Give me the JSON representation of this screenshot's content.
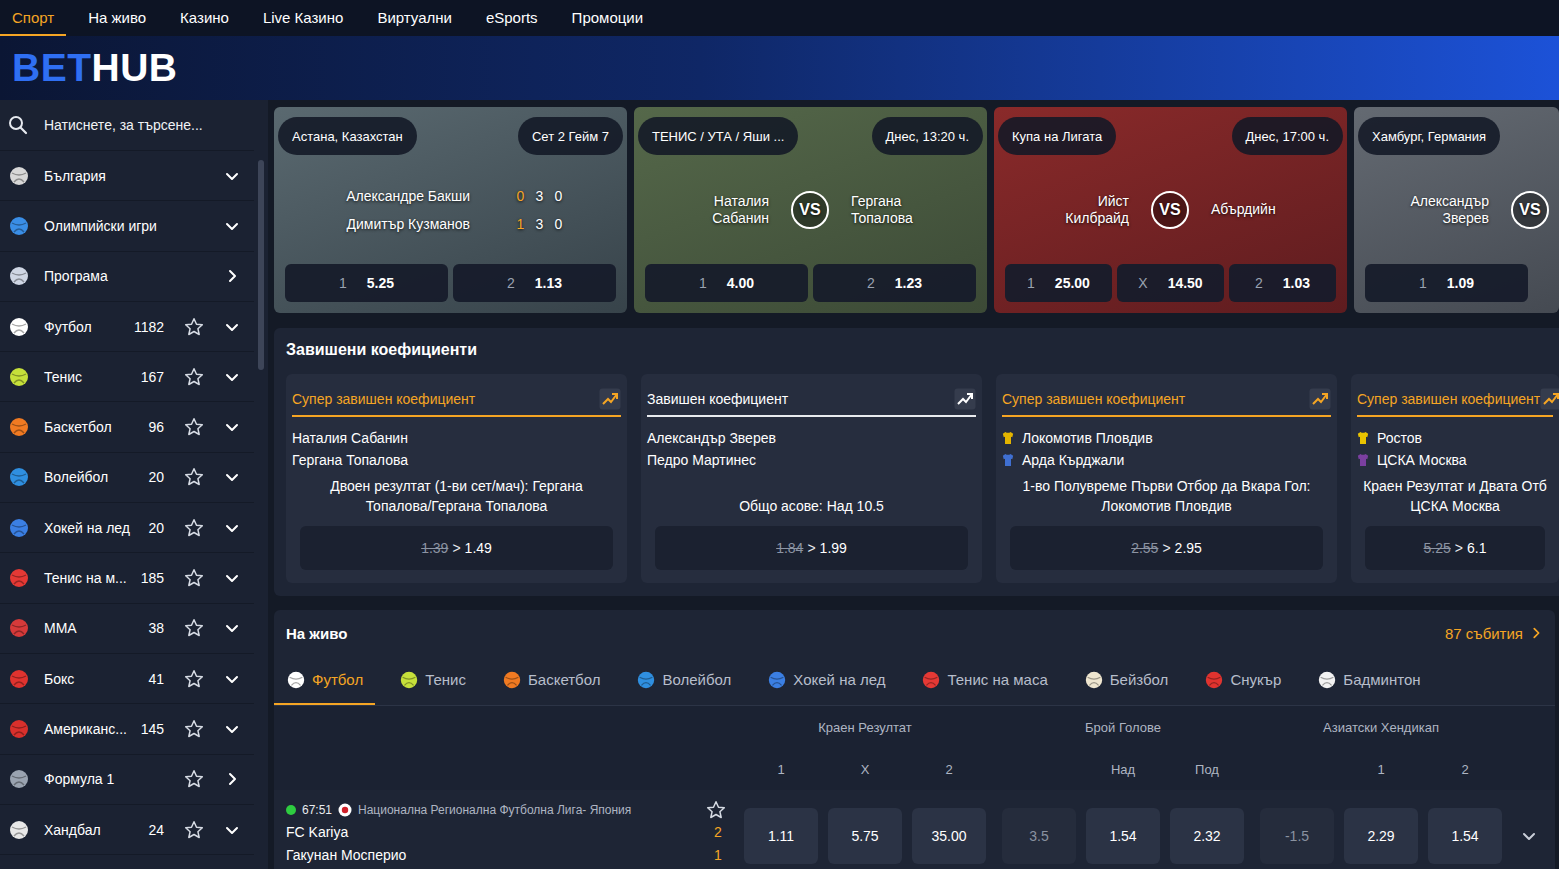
{
  "topnav": {
    "items": [
      {
        "label": "Спорт",
        "selected": true
      },
      {
        "label": "На живо",
        "selected": false
      },
      {
        "label": "Казино",
        "selected": false
      },
      {
        "label": "Live Казино",
        "selected": false
      },
      {
        "label": "Виртуални",
        "selected": false
      },
      {
        "label": "eSports",
        "selected": false
      },
      {
        "label": "Промоции",
        "selected": false
      }
    ]
  },
  "logo": {
    "accent": "BET",
    "rest": "HUB"
  },
  "sidebar": {
    "search": {
      "placeholder": "Натиснете, за търсене..."
    },
    "items": [
      {
        "label": "България",
        "kind": "group",
        "color": "#d8d8d8"
      },
      {
        "label": "Олимпийски игри",
        "kind": "group",
        "color": "#3a8ee6"
      },
      {
        "label": "Програма",
        "kind": "link",
        "color": "#cfd6e4"
      },
      {
        "label": "Футбол",
        "count": "1182",
        "kind": "sport",
        "favorite": false,
        "color": "#ffffff"
      },
      {
        "label": "Тенис",
        "count": "167",
        "kind": "sport",
        "favorite": false,
        "color": "#c6e03a"
      },
      {
        "label": "Баскетбол",
        "count": "96",
        "kind": "sport",
        "favorite": false,
        "color": "#f07a22"
      },
      {
        "label": "Волейбол",
        "count": "20",
        "kind": "sport",
        "favorite": false,
        "color": "#2f8fe0"
      },
      {
        "label": "Хокей на лед",
        "count": "20",
        "kind": "sport",
        "favorite": false,
        "color": "#3b7fe3"
      },
      {
        "label": "Тенис на м...",
        "count": "185",
        "kind": "sport",
        "favorite": false,
        "color": "#e53935"
      },
      {
        "label": "MMA",
        "count": "38",
        "kind": "sport",
        "favorite": false,
        "color": "#d63a3a"
      },
      {
        "label": "Бокс",
        "count": "41",
        "kind": "sport",
        "favorite": false,
        "color": "#e0332f"
      },
      {
        "label": "Американс...",
        "count": "145",
        "kind": "sport",
        "favorite": false,
        "color": "#d9302c"
      },
      {
        "label": "Формула 1",
        "kind": "sport-link",
        "favorite": false,
        "color": "#9aa3b0"
      },
      {
        "label": "Хандбал",
        "count": "24",
        "kind": "sport",
        "favorite": false,
        "color": "#e8e8e8"
      }
    ]
  },
  "featured": [
    {
      "kind": "live",
      "location": "Астана, Казахстан",
      "status": "Сет 2 Гейм 7",
      "players": [
        {
          "name": "Александре Бакши",
          "scores": [
            "0",
            "3",
            "0"
          ]
        },
        {
          "name": "Димитър Кузманов",
          "scores": [
            "1",
            "3",
            "0"
          ]
        }
      ],
      "odds": [
        {
          "label": "1",
          "value": "5.25"
        },
        {
          "label": "2",
          "value": "1.13"
        }
      ]
    },
    {
      "kind": "match",
      "location": "ТЕНИС / УТА / Яши ...",
      "status": "Днес, 13:20 ч.",
      "home": "Наталия Сабанин",
      "vs": "VS",
      "away": "Гергана Топалова",
      "odds": [
        {
          "label": "1",
          "value": "4.00"
        },
        {
          "label": "2",
          "value": "1.23"
        }
      ]
    },
    {
      "kind": "match",
      "location": "Купа на Лигата",
      "status": "Днес, 17:00 ч.",
      "home": "Ийст Килбрайд",
      "vs": "VS",
      "away": "Абърдийн",
      "odds": [
        {
          "label": "1",
          "value": "25.00"
        },
        {
          "label": "X",
          "value": "14.50"
        },
        {
          "label": "2",
          "value": "1.03"
        }
      ]
    },
    {
      "kind": "match",
      "location": "Хамбург, Германия",
      "home": "Александър Зверев",
      "vs": "VS",
      "odds": [
        {
          "label": "1",
          "value": "1.09"
        }
      ]
    }
  ],
  "boosted": {
    "title": "Завишени коефициенти",
    "cards": [
      {
        "kind": "super",
        "label": "Супер завишен коефициент",
        "teams": [
          {
            "name": "Наталия Сабанин"
          },
          {
            "name": "Гергана Топалова"
          }
        ],
        "market": [
          "Двоен резултат (1-ви сет/мач): Гергана",
          "Топалова/Гергана Топалова"
        ],
        "old": "1.39",
        "sep": ">",
        "new": "1.49"
      },
      {
        "kind": "regular",
        "label": "Завишен коефициент",
        "teams": [
          {
            "name": "Александър Зверев"
          },
          {
            "name": "Педро Мартинес"
          }
        ],
        "market": [
          "Общо асове: Над 10.5"
        ],
        "old": "1.84",
        "sep": ">",
        "new": "1.99"
      },
      {
        "kind": "super",
        "label": "Супер завишен коефициент",
        "teams": [
          {
            "name": "Локомотив Пловдив",
            "color": "#e3b400"
          },
          {
            "name": "Арда Кърджали",
            "color": "#3f6fd1"
          }
        ],
        "market": [
          "1-во Полувреме Първи Отбор да Вкара Гол:",
          "Локомотив Пловдив"
        ],
        "old": "2.55",
        "sep": ">",
        "new": "2.95"
      },
      {
        "kind": "super",
        "label": "Супер завишен коефициент",
        "teams": [
          {
            "name": "Ростов",
            "color": "#e9c300"
          },
          {
            "name": "ЦСКА Москва",
            "color": "#7b3fa0"
          }
        ],
        "market": [
          "Краен Резултат и Двата Отб",
          "ЦСКА Москва"
        ],
        "old": "5.25",
        "sep": ">",
        "new": "6.1"
      }
    ]
  },
  "live": {
    "title": "На живо",
    "events": "87 събития",
    "tabs": [
      {
        "label": "Футбол",
        "selected": true,
        "color": "#ffffff"
      },
      {
        "label": "Тенис",
        "selected": false,
        "color": "#c6e03a"
      },
      {
        "label": "Баскетбол",
        "selected": false,
        "color": "#f07a22"
      },
      {
        "label": "Волейбол",
        "selected": false,
        "color": "#2f8fe0"
      },
      {
        "label": "Хокей на лед",
        "selected": false,
        "color": "#3b7fe3"
      },
      {
        "label": "Тенис на маса",
        "selected": false,
        "color": "#e53935"
      },
      {
        "label": "Бейзбол",
        "selected": false,
        "color": "#efe6d0"
      },
      {
        "label": "Снукър",
        "selected": false,
        "color": "#e0332f"
      },
      {
        "label": "Бадминтон",
        "selected": false,
        "color": "#f2f2f2"
      }
    ],
    "groups": [
      {
        "label": "Краен Резултат",
        "kind": "plain",
        "columns": [
          "1",
          "X",
          "2"
        ]
      },
      {
        "label": "Брой Голове",
        "kind": "with-line",
        "columns": [
          "Над",
          "Под"
        ]
      },
      {
        "label": "Азиатски Хендикап",
        "kind": "with-line",
        "columns": [
          "1",
          "2"
        ]
      }
    ],
    "matches": [
      {
        "live": true,
        "time": "67:51",
        "league": "Национална Регионална Футболна Лига- Япония",
        "favorite": false,
        "teams": [
          {
            "name": "FC Kariya",
            "score": "2"
          },
          {
            "name": "Гакунан Мосперио",
            "score": "1"
          }
        ],
        "odds": [
          {
            "value": "1.11",
            "kind": "price"
          },
          {
            "value": "5.75",
            "kind": "price"
          },
          {
            "value": "35.00",
            "kind": "price"
          },
          {
            "value": "3.5",
            "kind": "line"
          },
          {
            "value": "1.54",
            "kind": "price"
          },
          {
            "value": "2.32",
            "kind": "price"
          },
          {
            "value": "-1.5",
            "kind": "line"
          },
          {
            "value": "2.29",
            "kind": "price"
          },
          {
            "value": "1.54",
            "kind": "price"
          }
        ]
      }
    ]
  }
}
